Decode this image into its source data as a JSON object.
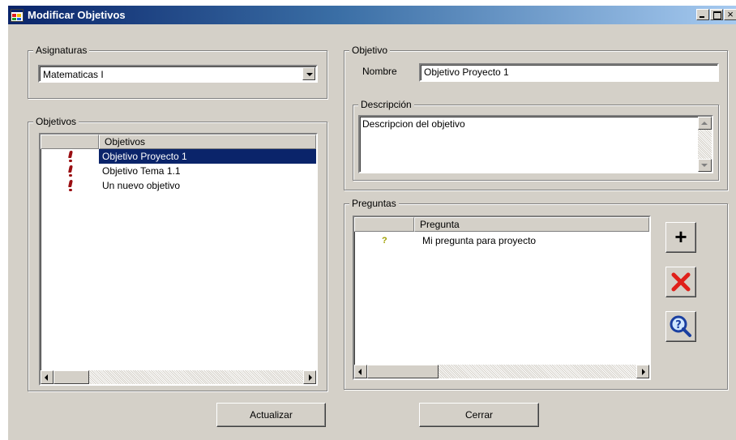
{
  "window": {
    "title": "Modificar Objetivos",
    "controls": {
      "minimize": "_",
      "maximize": "□",
      "close": "×"
    }
  },
  "asignaturas": {
    "legend": "Asignaturas",
    "selected": "Matematicas I"
  },
  "objetivos_list": {
    "legend": "Objetivos",
    "column_header": "Objetivos",
    "rows": [
      {
        "text": "Objetivo Proyecto 1",
        "selected": true
      },
      {
        "text": "Objetivo Tema 1.1",
        "selected": false
      },
      {
        "text": "Un nuevo objetivo",
        "selected": false
      }
    ]
  },
  "objetivo": {
    "legend": "Objetivo",
    "nombre_label": "Nombre",
    "nombre_value": "Objetivo Proyecto 1",
    "descripcion_legend": "Descripción",
    "descripcion_value": "Descripcion del objetivo"
  },
  "preguntas": {
    "legend": "Preguntas",
    "column_header": "Pregunta",
    "rows": [
      {
        "text": "Mi pregunta para proyecto"
      }
    ]
  },
  "buttons": {
    "actualizar": "Actualizar",
    "cerrar": "Cerrar",
    "add": "+"
  },
  "colors": {
    "title_gradient_start": "#0a246a",
    "title_gradient_end": "#a6caf0",
    "selection": "#0a246a",
    "face": "#d4d0c8",
    "delete_x": "#e0201a",
    "exclamation": "#9a0e12"
  },
  "icons": {
    "app": "form-icon",
    "objective_row": "exclamation-icon",
    "question_row": "question-mark-icon",
    "add": "plus-icon",
    "delete": "red-x-icon",
    "inspect": "magnifier-question-icon"
  }
}
